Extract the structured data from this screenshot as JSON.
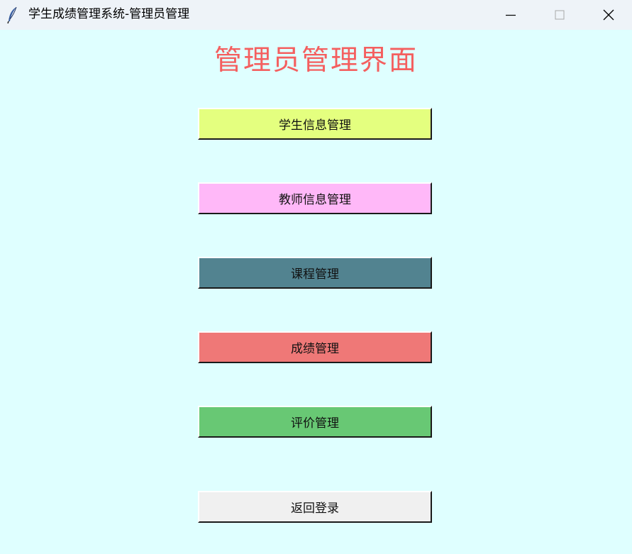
{
  "window": {
    "title": "学生成绩管理系统-管理员管理",
    "app_icon": "feather-icon",
    "controls": {
      "minimize_icon": "minimize-icon",
      "maximize_icon": "maximize-icon",
      "close_icon": "close-icon"
    }
  },
  "page": {
    "heading": "管理员管理界面",
    "heading_color": "#f45f5f",
    "background": "#dfffff"
  },
  "buttons": [
    {
      "label": "学生信息管理",
      "color": "#e4ff7f"
    },
    {
      "label": "教师信息管理",
      "color": "#ffb8f8"
    },
    {
      "label": "课程管理",
      "color": "#528390"
    },
    {
      "label": "成绩管理",
      "color": "#ef7877"
    },
    {
      "label": "评价管理",
      "color": "#68c874"
    },
    {
      "label": "返回登录",
      "color": "#f0f0f0"
    }
  ]
}
